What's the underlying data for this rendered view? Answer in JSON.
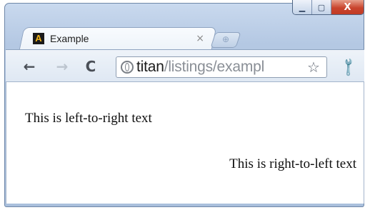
{
  "window": {
    "controls": {
      "minimize_glyph": "▁",
      "maximize_glyph": "▢",
      "close_glyph": "X"
    }
  },
  "tab": {
    "favicon_letter": "A",
    "title": "Example",
    "close_glyph": "×",
    "new_tab_glyph": "⊕"
  },
  "toolbar": {
    "back_glyph": "←",
    "forward_glyph": "→",
    "reload_glyph": "C",
    "url_host": "titan",
    "url_path": "/listings/exampl",
    "star_glyph": "☆",
    "wrench_glyph": "🔧"
  },
  "page": {
    "ltr_text": "This is left-to-right text",
    "rtl_text": "This is right-to-left text"
  },
  "icons": [
    "minimize-icon",
    "maximize-icon",
    "close-icon",
    "favicon-icon",
    "tab-close-icon",
    "new-tab-icon",
    "back-icon",
    "forward-icon",
    "reload-icon",
    "globe-icon",
    "star-icon",
    "wrench-icon"
  ],
  "colors": {
    "titlebar": "#b4c8e3",
    "close_button": "#c9452e",
    "url_host": "#1b1b1b",
    "url_path": "#8a8f96"
  }
}
